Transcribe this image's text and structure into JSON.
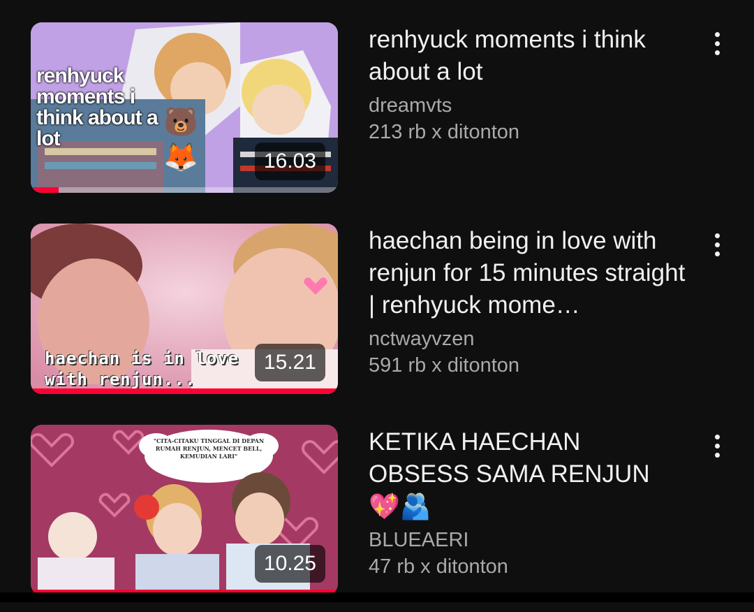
{
  "videos": [
    {
      "title": "renhyuck moments i think about a lot",
      "channel": "dreamvts",
      "views": "213 rb x ditonton",
      "duration": "16.03",
      "thumb_caption": "renhyuck moments i think about a lot",
      "thumb_emoji": "🐻 🦊",
      "progress": 0.09,
      "more_icon": "more-vert-icon"
    },
    {
      "title": "haechan being in love with renjun for 15 minutes straight | renhyuck mome…",
      "channel": "nctwayvzen",
      "views": "591 rb x ditonton",
      "duration": "15.21",
      "thumb_caption": "haechan is in love with renjun...",
      "progress": 1.0,
      "more_icon": "more-vert-icon"
    },
    {
      "title_line1": "KETIKA HAECHAN",
      "title_line2": "OBSESS SAMA RENJUN",
      "title_emoji": "💖🫂",
      "channel": "BLUEAERI",
      "views": "47 rb x ditonton",
      "duration": "10.25",
      "thumb_bubble": "\"CITA-CITAKU TINGGAL DI DEPAN RUMAH RENJUN, MENCET BELL, KEMUDIAN LARI\"",
      "progress": 1.0,
      "more_icon": "more-vert-icon"
    }
  ],
  "colors": {
    "background": "#0f0f0f",
    "title": "#f1f1f1",
    "secondary": "#aaaaaa",
    "progress": "#ff0033"
  }
}
